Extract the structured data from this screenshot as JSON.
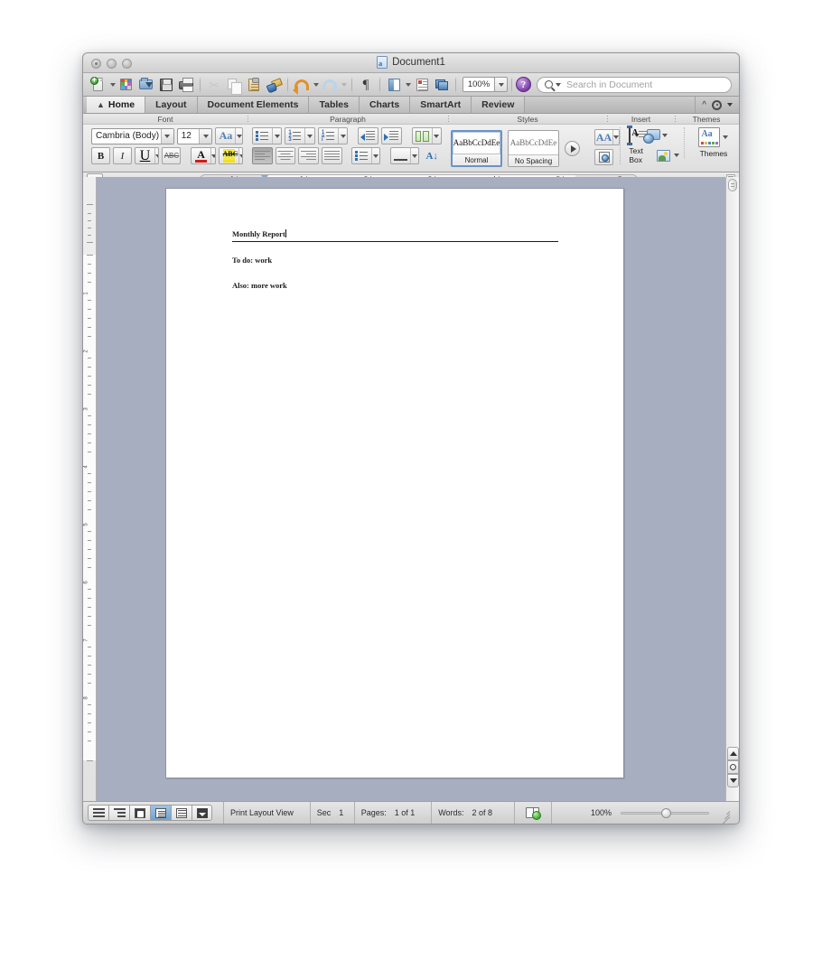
{
  "window": {
    "title": "Document1",
    "doc_icon": "word-document-icon",
    "traffic_lights": [
      "close",
      "minimize",
      "zoom"
    ]
  },
  "toolbar": {
    "items": [
      {
        "name": "new-document",
        "icon": "new-page-icon",
        "has_arrow": true
      },
      {
        "name": "open-gallery",
        "icon": "template-gallery-icon",
        "has_arrow": false
      },
      {
        "name": "open-document",
        "icon": "open-folder-icon",
        "has_arrow": false
      },
      {
        "name": "save",
        "icon": "floppy-disk-icon",
        "has_arrow": false
      },
      {
        "name": "print",
        "icon": "printer-icon",
        "has_arrow": false
      },
      {
        "name": "cut",
        "icon": "scissors-icon",
        "has_arrow": false
      },
      {
        "name": "copy",
        "icon": "copy-icon",
        "has_arrow": false
      },
      {
        "name": "paste",
        "icon": "clipboard-icon",
        "has_arrow": false
      },
      {
        "name": "format-painter",
        "icon": "paintbrush-icon",
        "has_arrow": false
      },
      {
        "name": "undo",
        "icon": "undo-arrow-icon",
        "has_arrow": true
      },
      {
        "name": "redo",
        "icon": "redo-arrow-icon",
        "has_arrow": true
      },
      {
        "name": "show-formatting",
        "icon": "pilcrow-icon",
        "has_arrow": false
      },
      {
        "name": "sidebar",
        "icon": "sidebar-panel-icon",
        "has_arrow": true
      },
      {
        "name": "notebook",
        "icon": "notebook-layout-icon",
        "has_arrow": false
      },
      {
        "name": "media-browser",
        "icon": "media-browser-icon",
        "has_arrow": false
      }
    ],
    "zoom_value": "100%",
    "help_label": "?",
    "search_placeholder": "Search in Document"
  },
  "tabs": [
    {
      "label": "Home",
      "active": true,
      "icon": "home-icon"
    },
    {
      "label": "Layout",
      "active": false
    },
    {
      "label": "Document Elements",
      "active": false
    },
    {
      "label": "Tables",
      "active": false
    },
    {
      "label": "Charts",
      "active": false
    },
    {
      "label": "SmartArt",
      "active": false
    },
    {
      "label": "Review",
      "active": false
    }
  ],
  "ribbon": {
    "groups": [
      {
        "label": "Font"
      },
      {
        "label": "Paragraph"
      },
      {
        "label": "Styles"
      },
      {
        "label": "Insert"
      },
      {
        "label": "Themes"
      }
    ],
    "font": {
      "family": "Cambria (Body)",
      "size": "12",
      "change_case_label": "Aa",
      "bold": "B",
      "italic": "I",
      "underline": "U",
      "strikethrough": "ABC",
      "font_color": "A",
      "font_color_hex": "#d01c1c",
      "highlight": "ABC",
      "highlight_hex": "#f2e01c"
    },
    "paragraph": {
      "bulleted_list": "bulleted-list-icon",
      "numbered_list": "numbered-list-icon",
      "multilevel_list": "multilevel-list-icon",
      "decrease_indent": "decrease-indent-icon",
      "increase_indent": "increase-indent-icon",
      "columns": "columns-icon",
      "align_left": "align-left-icon",
      "align_center": "align-center-icon",
      "align_right": "align-right-icon",
      "align_justify": "align-justify-icon",
      "line_spacing": "line-spacing-icon",
      "borders": "borders-icon",
      "sort": "sort-az-icon"
    },
    "styles": {
      "cards": [
        {
          "preview": "AaBbCcDdEe",
          "name": "Normal",
          "selected": true
        },
        {
          "preview": "AaBbCcDdEe",
          "name": "No Spacing",
          "selected": false
        }
      ],
      "more_button": "styles-more-icon",
      "manage_styles": "manage-styles-icon",
      "styles_pane": "styles-pane-icon"
    },
    "insert": {
      "text_box_label": "Text Box",
      "shapes_icon": "shapes-icon",
      "picture_icon": "picture-icon"
    },
    "themes": {
      "label": "Themes",
      "icon": "themes-icon"
    },
    "collapse_icon": "chevron-up-icon",
    "settings_icon": "gear-icon"
  },
  "ruler": {
    "tabstop_marker": "tab-stop-icon",
    "numbers": [
      "1",
      "1",
      "2",
      "3",
      "4",
      "5",
      "7"
    ],
    "unit": "inches"
  },
  "document": {
    "paragraphs": [
      {
        "text": "Monthly Report",
        "style": "heading-with-rule",
        "has_caret": true
      },
      {
        "text": "To do: work",
        "style": "body"
      },
      {
        "text": "Also: more work",
        "style": "body"
      }
    ]
  },
  "statusbar": {
    "views": [
      {
        "name": "draft-view",
        "icon": "draft-view-icon",
        "active": false
      },
      {
        "name": "outline-view",
        "icon": "outline-view-icon",
        "active": false
      },
      {
        "name": "publishing-layout-view",
        "icon": "publishing-layout-icon",
        "active": false
      },
      {
        "name": "print-layout-view",
        "icon": "print-layout-icon",
        "active": true
      },
      {
        "name": "notebook-layout-view",
        "icon": "notebook-layout-icon",
        "active": false
      },
      {
        "name": "focus-view",
        "icon": "focus-view-icon",
        "active": false
      }
    ],
    "view_name": "Print Layout View",
    "sec_label": "Sec",
    "sec_value": "1",
    "pages_label": "Pages:",
    "pages_value": "1 of 1",
    "words_label": "Words:",
    "words_value": "2 of 8",
    "spellcheck_icon": "spellcheck-book-icon",
    "zoom_value": "100%",
    "resize_grip": "resize-grip-icon"
  },
  "scrollbar": {
    "prev_page": "previous-page-icon",
    "select_browse_object": "select-browse-object-icon",
    "next_page": "next-page-icon"
  }
}
